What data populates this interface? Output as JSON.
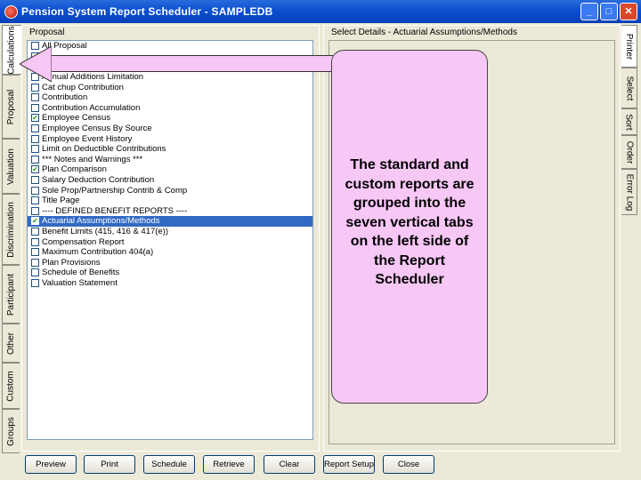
{
  "window": {
    "title": "Pension System Report Scheduler - SAMPLEDB",
    "minimize_label": "_",
    "maximize_label": "□",
    "close_label": "✕"
  },
  "left_tabs": [
    "Calculations",
    "Proposal",
    "Valuation",
    "Discrimination",
    "Participant",
    "Other",
    "Custom",
    "Groups"
  ],
  "right_tabs": [
    "Printer",
    "Select",
    "Sort",
    "Order",
    "Error Log"
  ],
  "left_panel": {
    "label": "Proposal",
    "items": [
      {
        "label": "All Proposal",
        "checked": false
      },
      {
        "label": "",
        "checked": false
      },
      {
        "label": "",
        "checked": false
      },
      {
        "label": "Annual Additions Limitation",
        "checked": false
      },
      {
        "label": "Cat chup Contribution",
        "checked": false
      },
      {
        "label": "Contribution",
        "checked": false
      },
      {
        "label": "Contribution Accumulation",
        "checked": false
      },
      {
        "label": "Employee Census",
        "checked": true
      },
      {
        "label": "Employee Census By Source",
        "checked": false
      },
      {
        "label": "Employee Event History",
        "checked": false
      },
      {
        "label": "Limit on Deductible Contributions",
        "checked": false
      },
      {
        "label": "*** Notes and Warnings ***",
        "checked": false
      },
      {
        "label": "Plan Comparison",
        "checked": true
      },
      {
        "label": "Salary Deduction Contribution",
        "checked": false
      },
      {
        "label": "Sole Prop/Partnership Contrib & Comp",
        "checked": false
      },
      {
        "label": "Title Page",
        "checked": false
      },
      {
        "label": "---- DEFINED BENEFIT REPORTS ----",
        "checked": false
      },
      {
        "label": "Actuarial Assumptions/Methods",
        "checked": true,
        "selected": true
      },
      {
        "label": "Benefit Limits (415, 416 & 417(e))",
        "checked": false
      },
      {
        "label": "Compensation Report",
        "checked": false
      },
      {
        "label": "Maximum Contribution 404(a)",
        "checked": false
      },
      {
        "label": "Plan Provisions",
        "checked": false
      },
      {
        "label": "Schedule of Benefits",
        "checked": false
      },
      {
        "label": "Valuation Statement",
        "checked": false
      }
    ]
  },
  "right_panel": {
    "label": "Select Details - Actuarial Assumptions/Methods"
  },
  "buttons": [
    "Preview",
    "Print",
    "Schedule",
    "Retrieve",
    "Clear",
    "Report Setup",
    "Close"
  ],
  "callout": {
    "text": "The standard and custom reports are grouped into the seven vertical tabs on the left side of the Report Scheduler"
  },
  "colors": {
    "titlebar": "#0a4fd0",
    "selection": "#316ac5",
    "callout_fill": "#f7c7f5",
    "frame": "#ece9d8"
  }
}
